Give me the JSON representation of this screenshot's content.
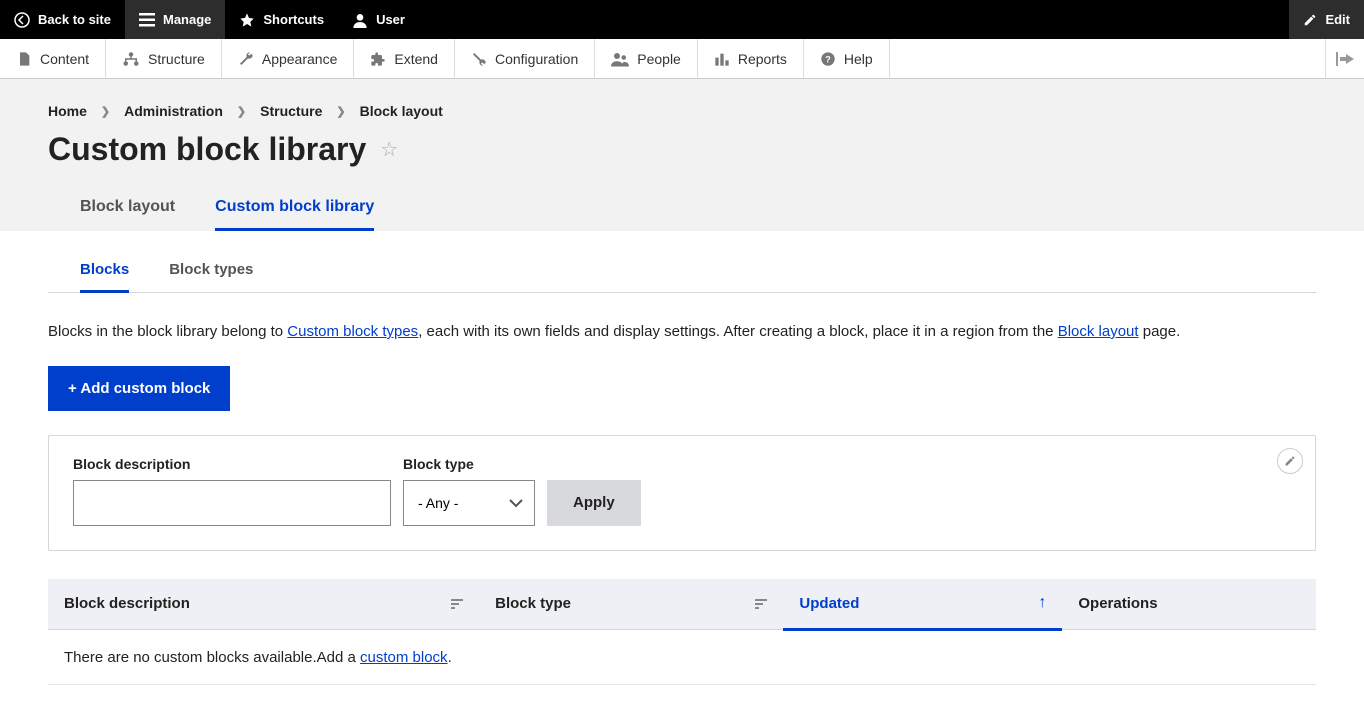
{
  "toolbar": {
    "back": "Back to site",
    "manage": "Manage",
    "shortcuts": "Shortcuts",
    "user": "User",
    "edit": "Edit"
  },
  "admin_menu": {
    "content": "Content",
    "structure": "Structure",
    "appearance": "Appearance",
    "extend": "Extend",
    "configuration": "Configuration",
    "people": "People",
    "reports": "Reports",
    "help": "Help"
  },
  "breadcrumb": {
    "home": "Home",
    "administration": "Administration",
    "structure": "Structure",
    "block_layout": "Block layout"
  },
  "page_title": "Custom block library",
  "primary_tabs": {
    "block_layout": "Block layout",
    "custom_block_library": "Custom block library"
  },
  "secondary_tabs": {
    "blocks": "Blocks",
    "block_types": "Block types"
  },
  "intro": {
    "part1": "Blocks in the block library belong to ",
    "link1": "Custom block types",
    "part2": ", each with its own fields and display settings. After creating a block, place it in a region from the ",
    "link2": "Block layout",
    "part3": " page."
  },
  "buttons": {
    "add_block": "+ Add custom block",
    "apply": "Apply"
  },
  "filters": {
    "desc_label": "Block description",
    "desc_value": "",
    "type_label": "Block type",
    "type_value": "- Any -"
  },
  "table": {
    "headers": {
      "description": "Block description",
      "type": "Block type",
      "updated": "Updated",
      "operations": "Operations"
    },
    "empty": {
      "text1": "There are no custom blocks available.",
      "text2": "Add a ",
      "link": "custom block",
      "text3": "."
    }
  }
}
